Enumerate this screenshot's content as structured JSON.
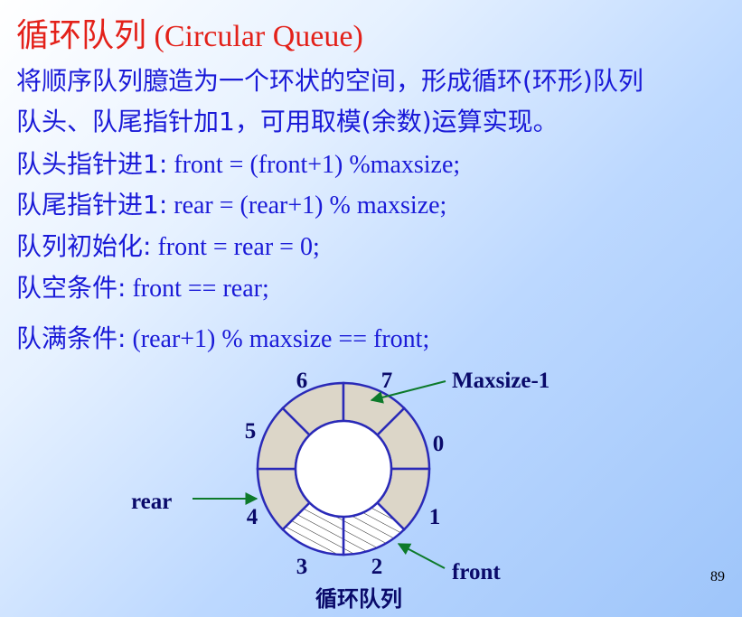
{
  "title": {
    "cjk": "循环队列",
    "latin": " (Circular Queue)"
  },
  "lines": [
    {
      "text": "将顺序队列臆造为一个环状的空间，形成循环(环形)队列"
    },
    {
      "text": "队头、队尾指针加1，可用取模(余数)运算实现。"
    },
    {
      "label": "队头指针进1:",
      "code": " front = (front+1) %maxsize;"
    },
    {
      "label": "队尾指针进1:",
      "code": " rear = (rear+1) % maxsize;"
    },
    {
      "label": "队列初始化:",
      "code": " front = rear = 0;"
    },
    {
      "label": "队空条件:",
      "code": " front == rear;"
    },
    {
      "label": "队满条件:",
      "code": " (rear+1) % maxsize == front;"
    }
  ],
  "diagram": {
    "indices": [
      "0",
      "1",
      "2",
      "3",
      "4",
      "5",
      "6",
      "7"
    ],
    "pointer_labels": {
      "maxsize": "Maxsize-1",
      "rear": "rear",
      "front": "front"
    },
    "caption": "循环队列",
    "colors": {
      "ring_fill": "#dcd6c8",
      "ring_stroke": "#2a2ab8",
      "arrow": "#0d7a2a",
      "label": "#0a0a6a"
    }
  },
  "page_number": "89"
}
